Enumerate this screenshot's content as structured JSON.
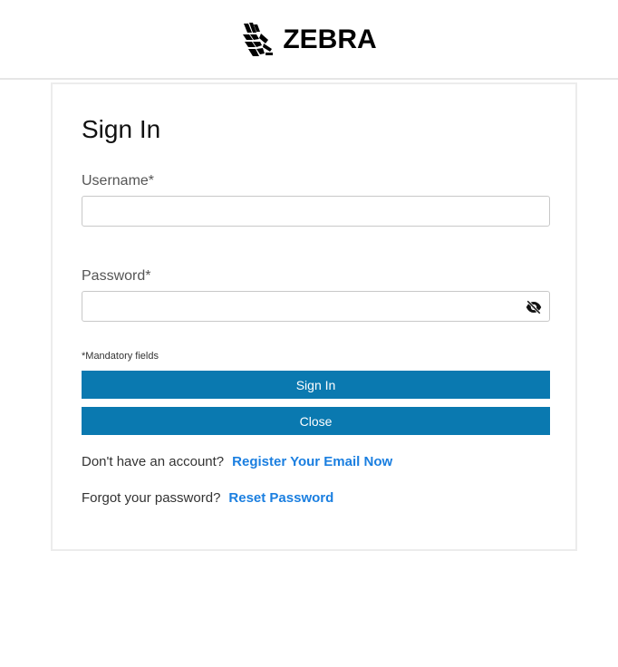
{
  "header": {
    "logo_text": "ZEBRA",
    "logo_icon": "zebra-head-icon"
  },
  "form": {
    "title": "Sign In",
    "username_label": "Username*",
    "username_value": "",
    "password_label": "Password*",
    "password_value": "",
    "password_toggle_icon": "eye-slash-icon",
    "mandatory_note": "*Mandatory fields",
    "signin_label": "Sign In",
    "close_label": "Close",
    "register_prompt": "Don't have an account?",
    "register_link": "Register Your Email Now",
    "forgot_prompt": "Forgot your password?",
    "reset_link": "Reset Password"
  },
  "colors": {
    "button": "#0a79b0",
    "link": "#1b7fe0"
  }
}
